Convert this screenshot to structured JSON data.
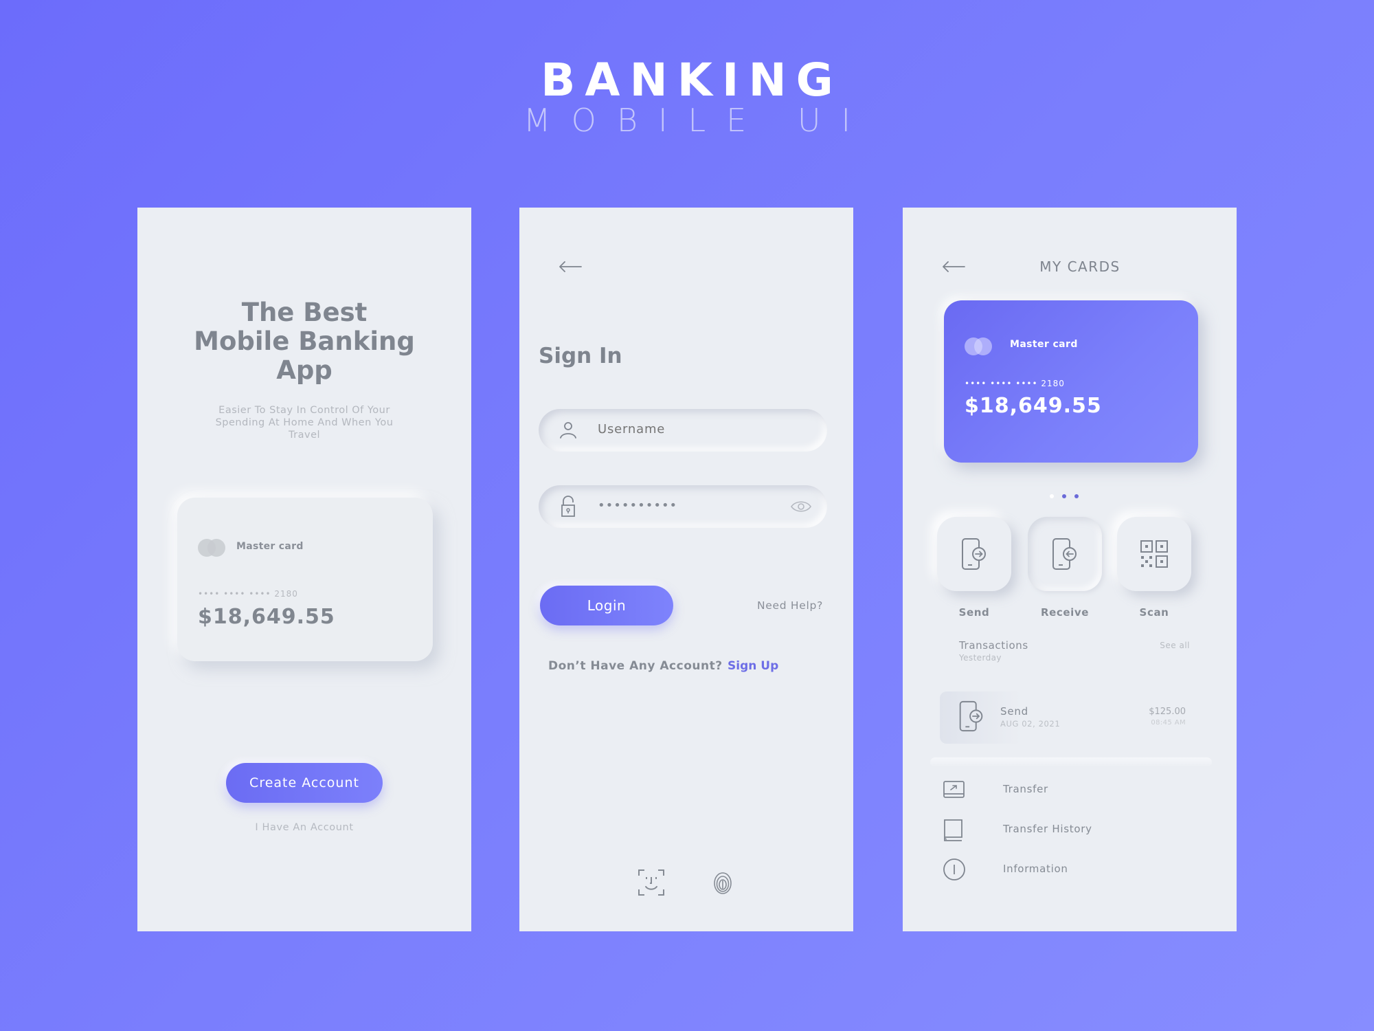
{
  "header": {
    "title": "BANKING",
    "subtitle": "MOBILE UI"
  },
  "colors": {
    "background_start": "#6c6cfb",
    "background_end": "#878dff",
    "panel": "#ebeef3",
    "accent": "#6d6ee6",
    "text_primary": "#7f858f",
    "text_muted": "#b5b9c0"
  },
  "welcome": {
    "title_lines": [
      "The Best",
      "Mobile Banking",
      "App"
    ],
    "subtitle_lines": [
      "Easier To Stay In Control Of Your",
      "Spending At Home And When You",
      "Travel"
    ],
    "card": {
      "brand": "Master card",
      "number": "•••• •••• •••• 2180",
      "balance": "$18,649.55"
    },
    "create_account_label": "Create Account",
    "have_account_label": "I Have An Account"
  },
  "signin": {
    "back_icon": "arrow-left-icon",
    "title": "Sign In",
    "username_placeholder": "Username",
    "password_value": "••••••••••",
    "login_label": "Login",
    "need_help_label": "Need Help?",
    "no_account_text": "Don’t Have Any Account?",
    "sign_up_label": "Sign Up",
    "biometrics": [
      "face-id-icon",
      "fingerprint-icon"
    ]
  },
  "my_cards": {
    "back_icon": "arrow-left-icon",
    "title": "MY CARDS",
    "card": {
      "brand": "Master card",
      "number": "•••• •••• •••• 2180",
      "balance": "$18,649.55"
    },
    "carousel": {
      "count": 3,
      "active_index": 0
    },
    "actions": [
      {
        "label": "Send",
        "icon": "phone-send-icon"
      },
      {
        "label": "Receive",
        "icon": "phone-receive-icon"
      },
      {
        "label": "Scan",
        "icon": "qr-code-icon"
      }
    ],
    "transactions": {
      "heading": "Transactions",
      "period": "Yesterday",
      "see_all_label": "See all",
      "items": [
        {
          "name": "Send",
          "date": "AUG 02, 2021",
          "amount": "$125.00",
          "time": "08:45 AM",
          "icon": "phone-send-icon"
        }
      ]
    },
    "menu": [
      {
        "label": "Transfer",
        "icon": "transfer-icon"
      },
      {
        "label": "Transfer History",
        "icon": "book-icon"
      },
      {
        "label": "Information",
        "icon": "info-icon"
      }
    ]
  }
}
